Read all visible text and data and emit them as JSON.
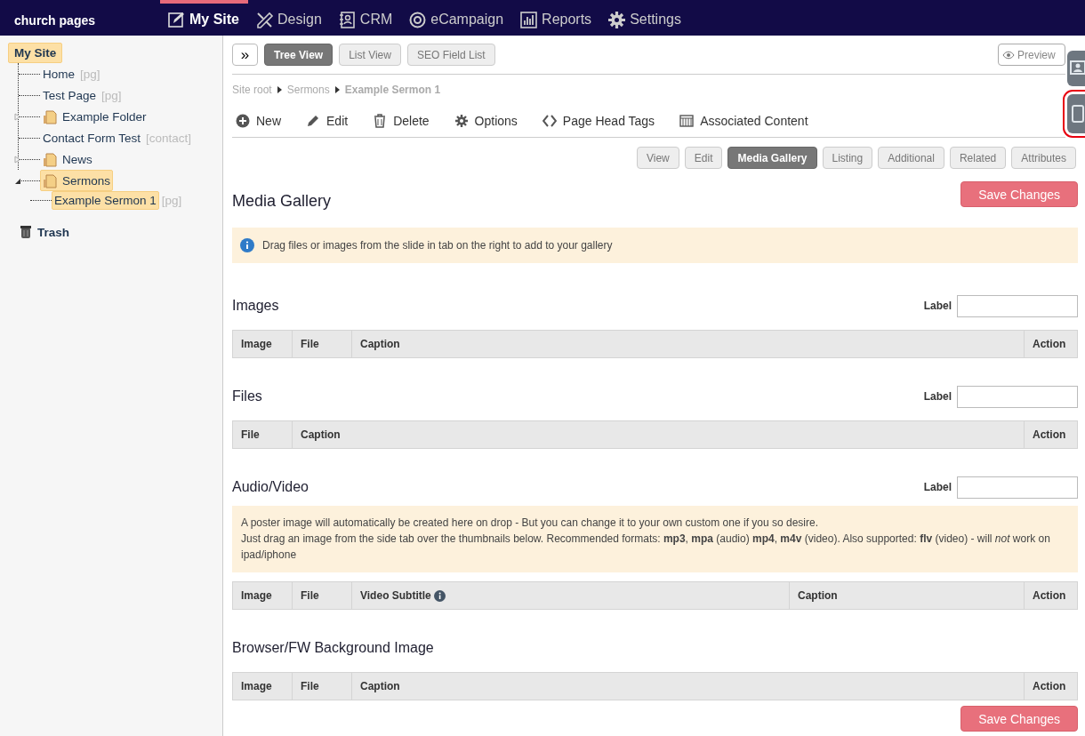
{
  "nav": {
    "logo": "church pages",
    "items": [
      {
        "label": "My Site",
        "selected": true
      },
      {
        "label": "Design",
        "selected": false
      },
      {
        "label": "CRM",
        "selected": false
      },
      {
        "label": "eCampaign",
        "selected": false
      },
      {
        "label": "Reports",
        "selected": false
      },
      {
        "label": "Settings",
        "selected": false
      }
    ]
  },
  "sidebar": {
    "tree": {
      "label": "My Site",
      "selected": true,
      "children": [
        {
          "label": "Home",
          "tag": "[pg]",
          "kind": "page",
          "selected": false
        },
        {
          "label": "Test Page",
          "tag": "[pg]",
          "kind": "page",
          "selected": false
        },
        {
          "label": "Example Folder",
          "kind": "folder",
          "expanded": false,
          "selected": false
        },
        {
          "label": "Contact Form Test",
          "tag": "[contact]",
          "kind": "page",
          "selected": false
        },
        {
          "label": "News",
          "kind": "folder",
          "expanded": false,
          "selected": false
        },
        {
          "label": "Sermons",
          "kind": "folder",
          "expanded": true,
          "selected": true,
          "children": [
            {
              "label": "Example Sermon 1",
              "tag": "[pg]",
              "kind": "page",
              "selected": true
            }
          ]
        }
      ]
    },
    "trash": "Trash"
  },
  "toolbar": {
    "expand": "»",
    "views": [
      {
        "label": "Tree View",
        "selected": true
      },
      {
        "label": "List View",
        "selected": false
      },
      {
        "label": "SEO Field List",
        "selected": false
      }
    ],
    "preview": "Preview"
  },
  "side_tabs": [
    {
      "highlighted": false
    },
    {
      "highlighted": true
    }
  ],
  "breadcrumb": [
    "Site root",
    "Sermons",
    "Example Sermon 1"
  ],
  "actions": [
    "New",
    "Edit",
    "Delete",
    "Options",
    "Page Head Tags",
    "Associated Content"
  ],
  "subtabs": [
    {
      "label": "View",
      "selected": false
    },
    {
      "label": "Edit",
      "selected": false
    },
    {
      "label": "Media Gallery",
      "selected": true
    },
    {
      "label": "Listing",
      "selected": false
    },
    {
      "label": "Additional",
      "selected": false
    },
    {
      "label": "Related",
      "selected": false
    },
    {
      "label": "Attributes",
      "selected": false
    }
  ],
  "title": "Media Gallery",
  "save": "Save Changes",
  "info": "Drag files or images from the slide in tab on the right to add to your gallery",
  "sections": [
    {
      "title": "Images",
      "field_label": "Label",
      "columns": [
        {
          "label": "Image",
          "kind": "narrow"
        },
        {
          "label": "File",
          "kind": "narrow"
        },
        {
          "label": "Caption",
          "kind": "flex"
        },
        {
          "label": "Action",
          "kind": "action"
        }
      ]
    },
    {
      "title": "Files",
      "field_label": "Label",
      "columns": [
        {
          "label": "File",
          "kind": "narrow"
        },
        {
          "label": "Caption",
          "kind": "flex"
        },
        {
          "label": "Action",
          "kind": "action"
        }
      ]
    },
    {
      "title": "Audio/Video",
      "field_label": "Label",
      "note": [
        "A poster image will automatically be created here on drop - But you can change it to your own custom one if you so desire.",
        "Just drag an image from the side tab over the thumbnails below. Recommended formats: **mp3**, **mpa** (audio) **mp4**, **m4v** (video). Also supported: **flv** (video) - will *not* work on ipad/iphone"
      ],
      "columns": [
        {
          "label": "Image",
          "kind": "narrow"
        },
        {
          "label": "File",
          "kind": "narrow"
        },
        {
          "label": "Video Subtitle",
          "kind": "flex",
          "info": true
        },
        {
          "label": "Caption",
          "kind": "medium"
        },
        {
          "label": "Action",
          "kind": "action"
        }
      ]
    },
    {
      "title": "Browser/FW Background Image",
      "columns": [
        {
          "label": "Image",
          "kind": "narrow"
        },
        {
          "label": "File",
          "kind": "narrow"
        },
        {
          "label": "Caption",
          "kind": "flex"
        },
        {
          "label": "Action",
          "kind": "action"
        }
      ]
    }
  ],
  "footer_save": "Save Changes"
}
